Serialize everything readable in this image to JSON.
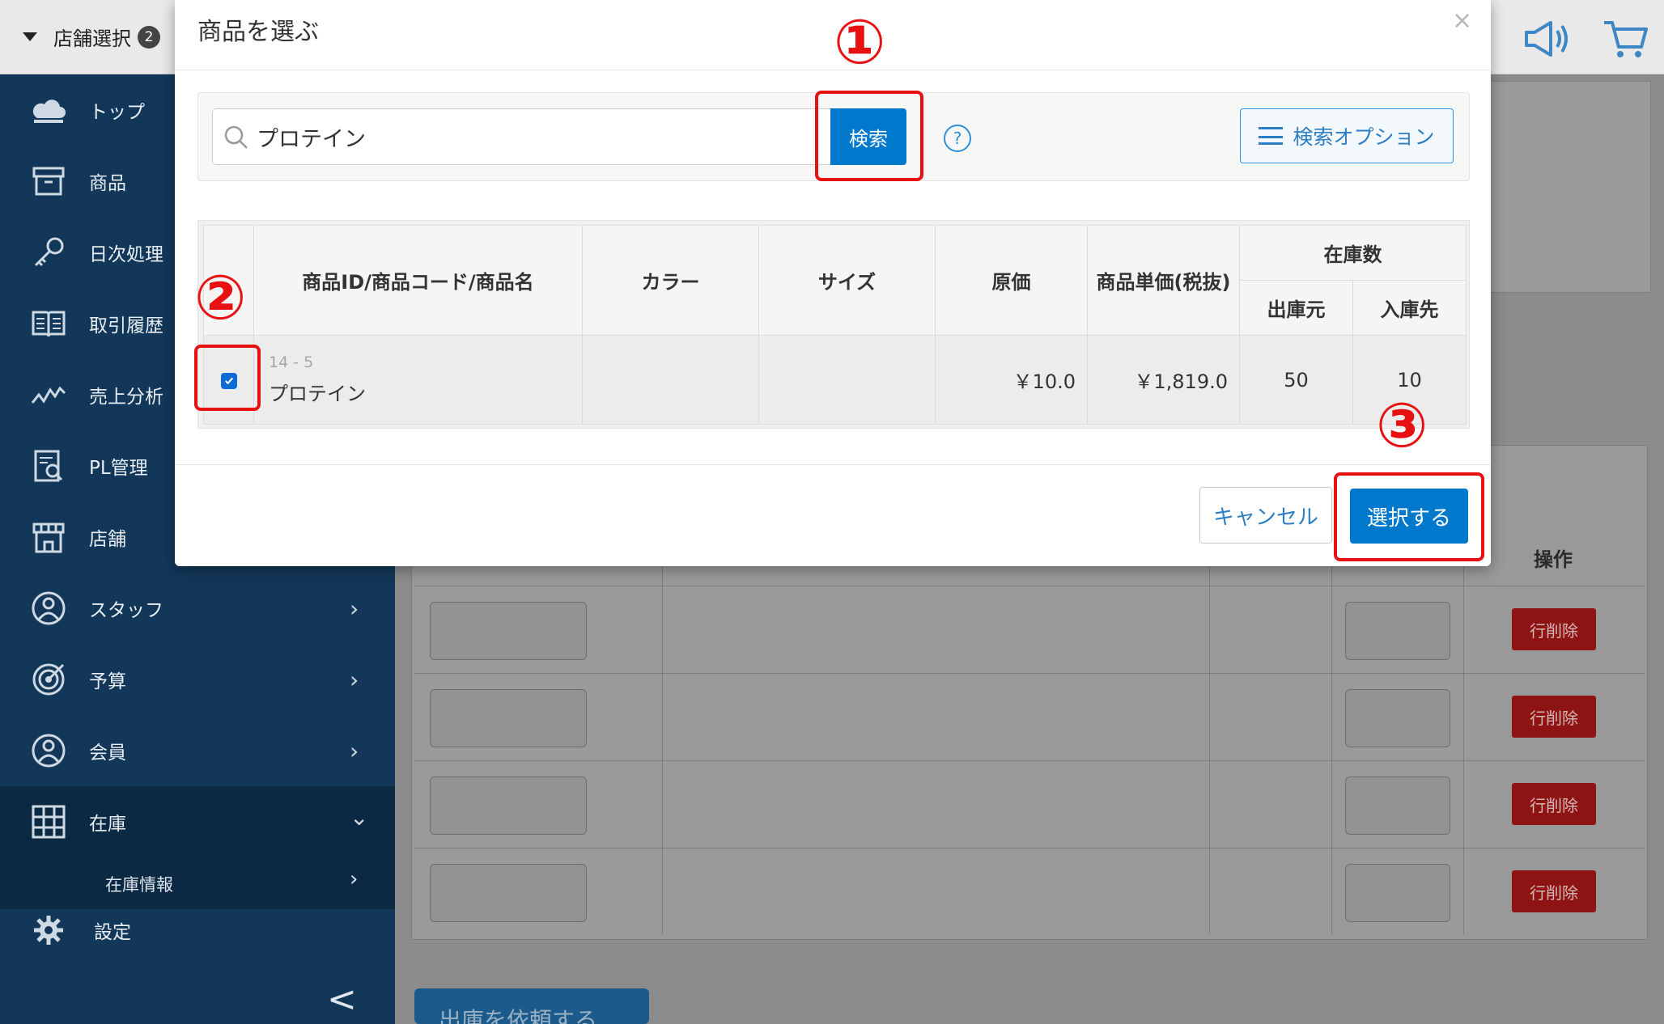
{
  "topbar": {
    "store_select_label": "店舗選択",
    "store_badge": "2",
    "icons": [
      "megaphone-icon",
      "cart-icon"
    ]
  },
  "sidebar": {
    "items": [
      {
        "label": "トップ",
        "icon": "cloud-icon"
      },
      {
        "label": "商品",
        "icon": "archive-box-icon"
      },
      {
        "label": "日次処理",
        "icon": "key-icon"
      },
      {
        "label": "取引履歴",
        "icon": "book-icon"
      },
      {
        "label": "売上分析",
        "icon": "trend-line-icon"
      },
      {
        "label": "PL管理",
        "icon": "report-icon"
      },
      {
        "label": "店舗",
        "icon": "storefront-icon"
      },
      {
        "label": "スタッフ",
        "icon": "staff-icon"
      },
      {
        "label": "予算",
        "icon": "target-icon"
      },
      {
        "label": "会員",
        "icon": "member-icon"
      },
      {
        "label": "在庫",
        "icon": "grid-icon"
      }
    ],
    "sub_item": "在庫情報",
    "settings": "設定",
    "chevron_right": "›",
    "chevron_down": "⌄",
    "collapse": "<"
  },
  "background": {
    "operation_header": "操作",
    "row_delete_label": "行削除",
    "submit_label": "出庫を依頼する"
  },
  "modal": {
    "title": "商品を選ぶ",
    "close": "×",
    "search": {
      "value": "プロテイン",
      "button": "検索",
      "help": "?",
      "options_button": "検索オプション"
    },
    "table": {
      "headers": {
        "product": "商品ID/商品コード/商品名",
        "color": "カラー",
        "size": "サイズ",
        "cost": "原価",
        "unit_price": "商品単価(税抜)",
        "stock": "在庫数",
        "stock_from": "出庫元",
        "stock_to": "入庫先"
      },
      "rows": [
        {
          "checked": true,
          "id": "14 - 5",
          "name": "プロテイン",
          "color": "",
          "size": "",
          "cost": "￥10.0",
          "unit_price": "￥1,819.0",
          "stock_from": "50",
          "stock_to": "10"
        }
      ]
    },
    "cancel": "キャンセル",
    "select": "選択する"
  },
  "annotations": {
    "marker_1": "①",
    "marker_2": "②",
    "marker_3": "③",
    "color": "#e81111"
  }
}
